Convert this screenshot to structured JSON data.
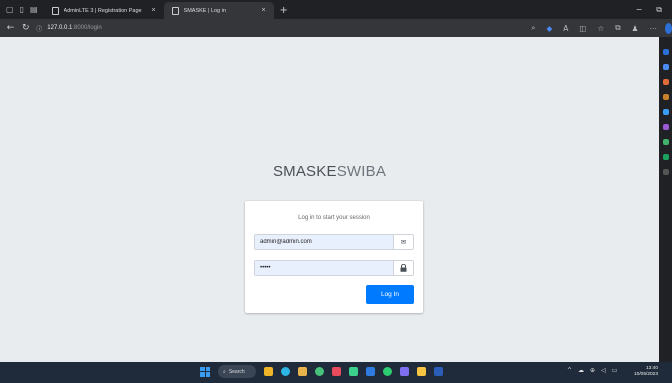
{
  "browser": {
    "tabs": [
      {
        "title": "AdminLTE 3 | Registration Page",
        "close": "×"
      },
      {
        "title": "SMASKE | Log in",
        "close": "×"
      }
    ],
    "new_tab": "+",
    "url_host": "127.0.0.1",
    "url_path": ":8000/login"
  },
  "page": {
    "logo_bold": "SMASKE",
    "logo_light": "SWIBA",
    "login_message": "Log in to start your session",
    "email_value": "admin@admin.com",
    "password_value": "•••••",
    "login_button": "Log In"
  },
  "taskbar": {
    "search_label": "Search",
    "time": "13:40",
    "date": "10/05/2023"
  },
  "colors": {
    "primary": "#007bff",
    "page_bg": "#e9ecef",
    "autofill_bg": "#e8f0fe"
  },
  "icons": [
    "back-icon",
    "refresh-icon",
    "info-icon",
    "envelope-icon",
    "lock-icon",
    "windows-icon",
    "search-icon"
  ]
}
